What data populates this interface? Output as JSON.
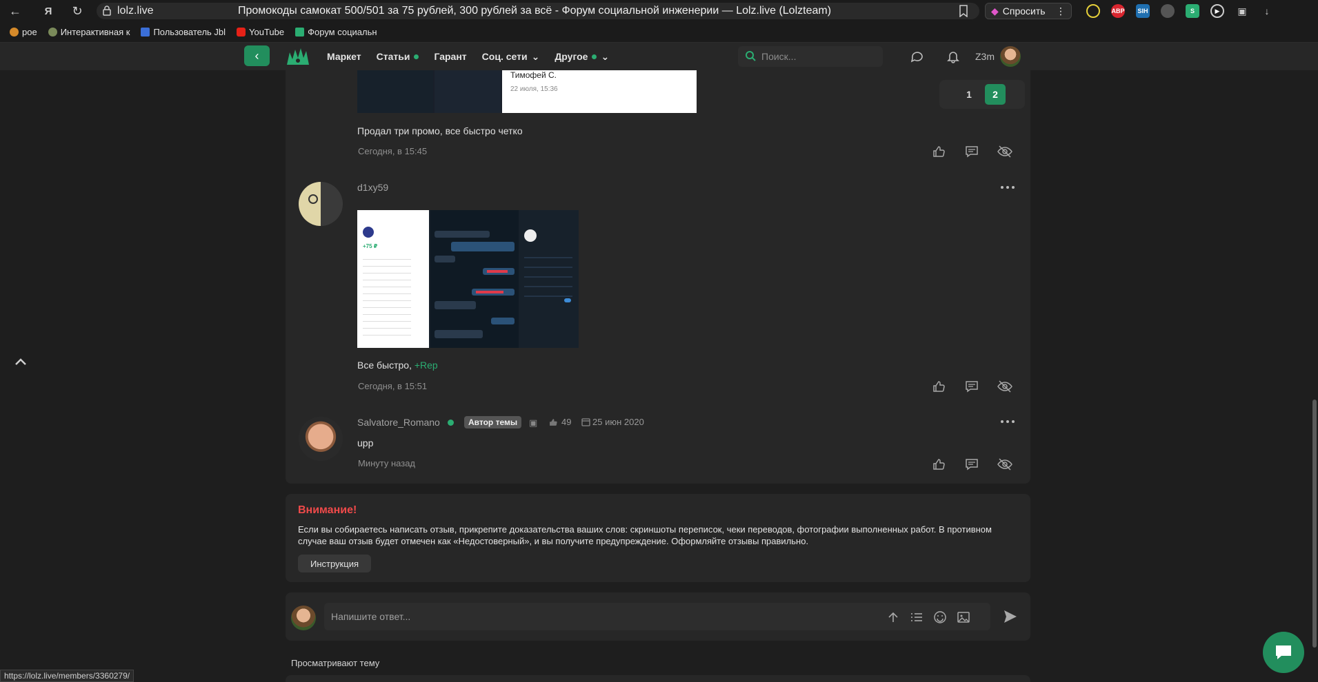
{
  "browser": {
    "url": "lolz.live",
    "tab_title": "Промокоды самокат 500/501 за 75 рублей, 300 рублей за всё - Форум социальной инженерии — Lolz.live (Lolzteam)",
    "ask_label": "Спросить",
    "status_url": "https://lolz.live/members/3360279/"
  },
  "bookmarks": [
    {
      "label": "poe",
      "icon": "poe-icon"
    },
    {
      "label": "Интерактивная к",
      "icon": "globe-icon"
    },
    {
      "label": "Пользователь Jbl",
      "icon": "facebook-icon"
    },
    {
      "label": "YouTube",
      "icon": "youtube-icon"
    },
    {
      "label": "Форум социальн",
      "icon": "lolz-icon"
    }
  ],
  "header": {
    "menu": [
      {
        "label": "Маркет"
      },
      {
        "label": "Статьи"
      },
      {
        "label": "Гарант"
      },
      {
        "label": "Соц. сети"
      },
      {
        "label": "Другое"
      }
    ],
    "search_placeholder": "Поиск...",
    "username": "Z3m"
  },
  "pagination": {
    "pages": [
      "1",
      "2"
    ],
    "active": "2"
  },
  "posts": [
    {
      "image_caption_name": "Тимофей С.",
      "image_caption_date": "22 июля, 15:36",
      "text": "Продал три промо, все быстро четко",
      "date": "Сегодня, в 15:45"
    },
    {
      "username": "d1xy59",
      "text": "Все быстро,",
      "rep": "+Rep",
      "date": "Сегодня, в 15:51",
      "screenshot_price": "+75 ₽"
    },
    {
      "username": "Salvatore_Romano",
      "badge": "Автор темы",
      "likes": "49",
      "joined": "25 июн 2020",
      "text": "upp",
      "date": "Минуту назад"
    }
  ],
  "attention": {
    "title": "Внимание!",
    "text": "Если вы собираетесь написать отзыв, прикрепите доказательства ваших слов: скриншоты переписок, чеки переводов, фотографии выполненных работ. В противном случае ваш отзыв будет отмечен как «Недостоверный», и вы получите предупреждение. Оформляйте отзывы правильно.",
    "button": "Инструкция"
  },
  "reply": {
    "placeholder": "Напишите ответ..."
  },
  "viewing": "Просматривают тему",
  "colors": {
    "accent": "#228e5d",
    "warning": "#ef4a4a",
    "background": "#1e1e1e",
    "panel": "#272727"
  }
}
